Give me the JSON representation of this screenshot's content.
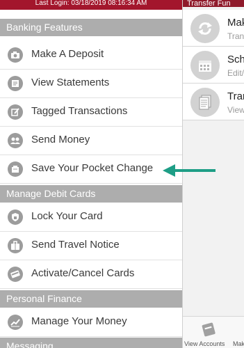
{
  "drawer": {
    "last_login": "Last Login: 03/18/2019 08:16:34 AM",
    "sections": {
      "banking": "Banking Features",
      "debit": "Manage Debit Cards",
      "finance": "Personal Finance",
      "messaging": "Messaging"
    },
    "items": {
      "deposit": "Make A Deposit",
      "statements": "View Statements",
      "tagged": "Tagged Transactions",
      "send_money": "Send Money",
      "pocket_change": "Save Your Pocket Change",
      "lock_card": "Lock Your Card",
      "travel": "Send Travel Notice",
      "activate": "Activate/Cancel Cards",
      "manage_money": "Manage Your Money"
    }
  },
  "right_panel": {
    "header": "Transfer Fun",
    "items": [
      {
        "title": "Mak",
        "subtitle": "Trans"
      },
      {
        "title": "Sch",
        "subtitle": "Edit/"
      },
      {
        "title": "Tran",
        "subtitle": "View"
      }
    ],
    "footer": {
      "view_accounts": "View Accounts",
      "make": "Mak"
    }
  },
  "colors": {
    "brand": "#a3162c",
    "section_header": "#adadad",
    "arrow": "#1e9e86"
  }
}
